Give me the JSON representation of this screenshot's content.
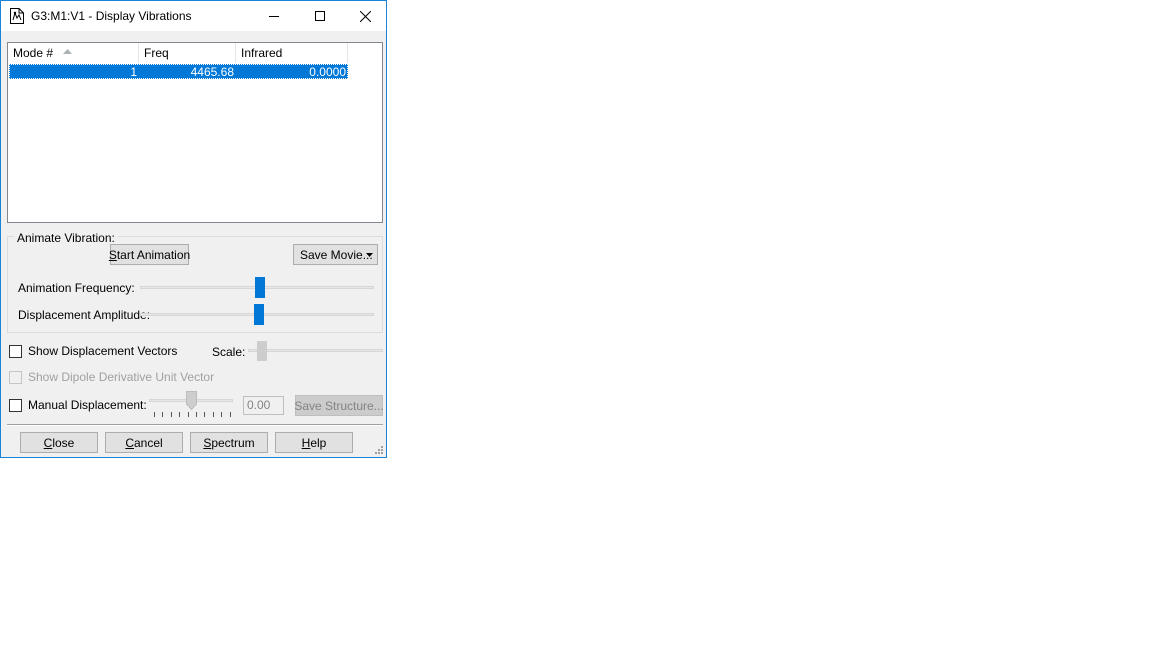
{
  "window": {
    "title": "G3:M1:V1 - Display Vibrations",
    "minimize_icon": "minimize-icon",
    "maximize_icon": "maximize-icon",
    "close_icon": "close-icon"
  },
  "table": {
    "columns": [
      "Mode #",
      "Freq",
      "Infrared"
    ],
    "sorted_column": "Mode #",
    "rows": [
      {
        "mode": "1",
        "freq": "4465.68",
        "infrared": "0.0000",
        "selected": true
      }
    ]
  },
  "animate": {
    "group_label": "Animate Vibration:",
    "start_label": "Start Animation",
    "save_movie_label": "Save Movie...",
    "frequency_label": "Animation Frequency:",
    "amplitude_label": "Displacement Amplitude:",
    "frequency_level": 0.49,
    "amplitude_level": 0.49
  },
  "options": {
    "show_vectors_label": "Show Displacement Vectors",
    "show_vectors_checked": false,
    "scale_label": "Scale:",
    "scale_enabled": false,
    "dipole_label": "Show Dipole Derivative Unit Vector",
    "dipole_enabled": false,
    "manual_label": "Manual Displacement:",
    "manual_checked": false,
    "manual_value": "0.00",
    "save_structure_label": "Save Structure..."
  },
  "footer": {
    "close_label": "Close",
    "cancel_label": "Cancel",
    "spectrum_label": "Spectrum",
    "help_label": "Help"
  },
  "colors": {
    "accent": "#0078d7",
    "window_border": "#1883d7",
    "dialog_bg": "#f0f0f0"
  }
}
